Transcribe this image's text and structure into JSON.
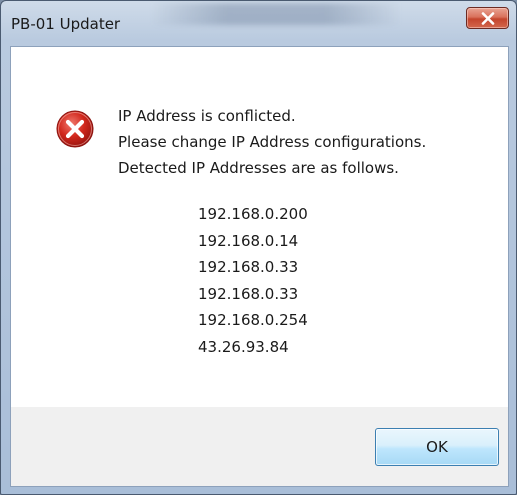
{
  "window": {
    "title": "PB-01 Updater",
    "close_icon": "close-icon"
  },
  "dialog": {
    "icon": "error-icon",
    "messages": [
      "IP Address is conflicted.",
      "Please change IP Address configurations.",
      "Detected IP Addresses are as follows."
    ],
    "ip_addresses": [
      "192.168.0.200",
      "192.168.0.14",
      "192.168.0.33",
      "192.168.0.33",
      "192.168.0.254",
      "43.26.93.84"
    ],
    "ok_label": "OK"
  },
  "colors": {
    "error_red": "#c8201a",
    "close_button_red": "#c4452d",
    "button_border": "#3c7fb1"
  }
}
